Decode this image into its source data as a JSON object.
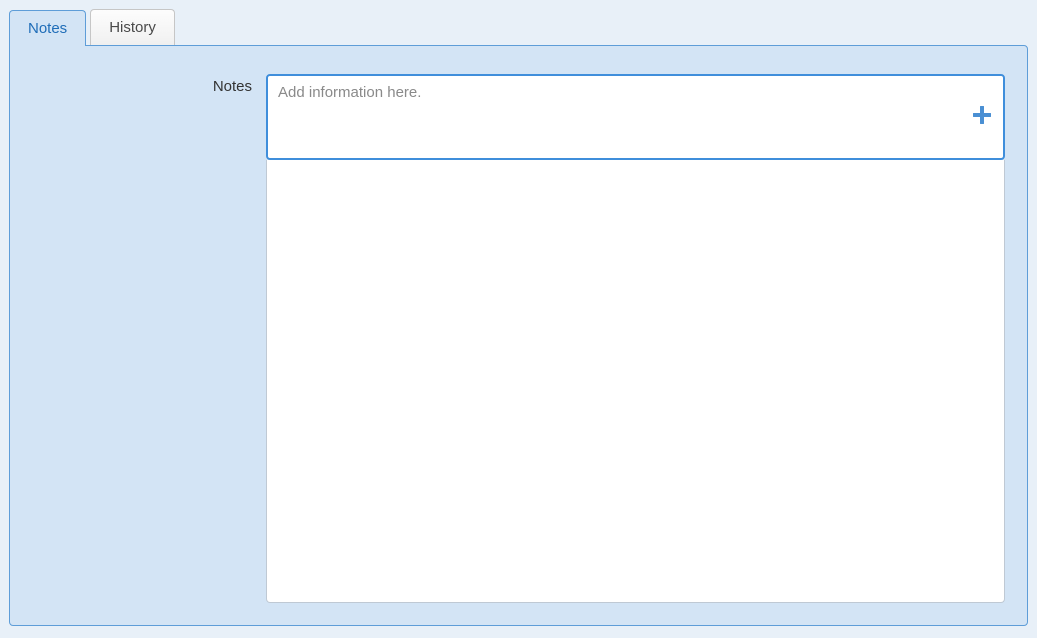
{
  "tabs": [
    {
      "label": "Notes",
      "active": true
    },
    {
      "label": "History",
      "active": false
    }
  ],
  "notes_field": {
    "label": "Notes",
    "placeholder": "Add information here."
  }
}
